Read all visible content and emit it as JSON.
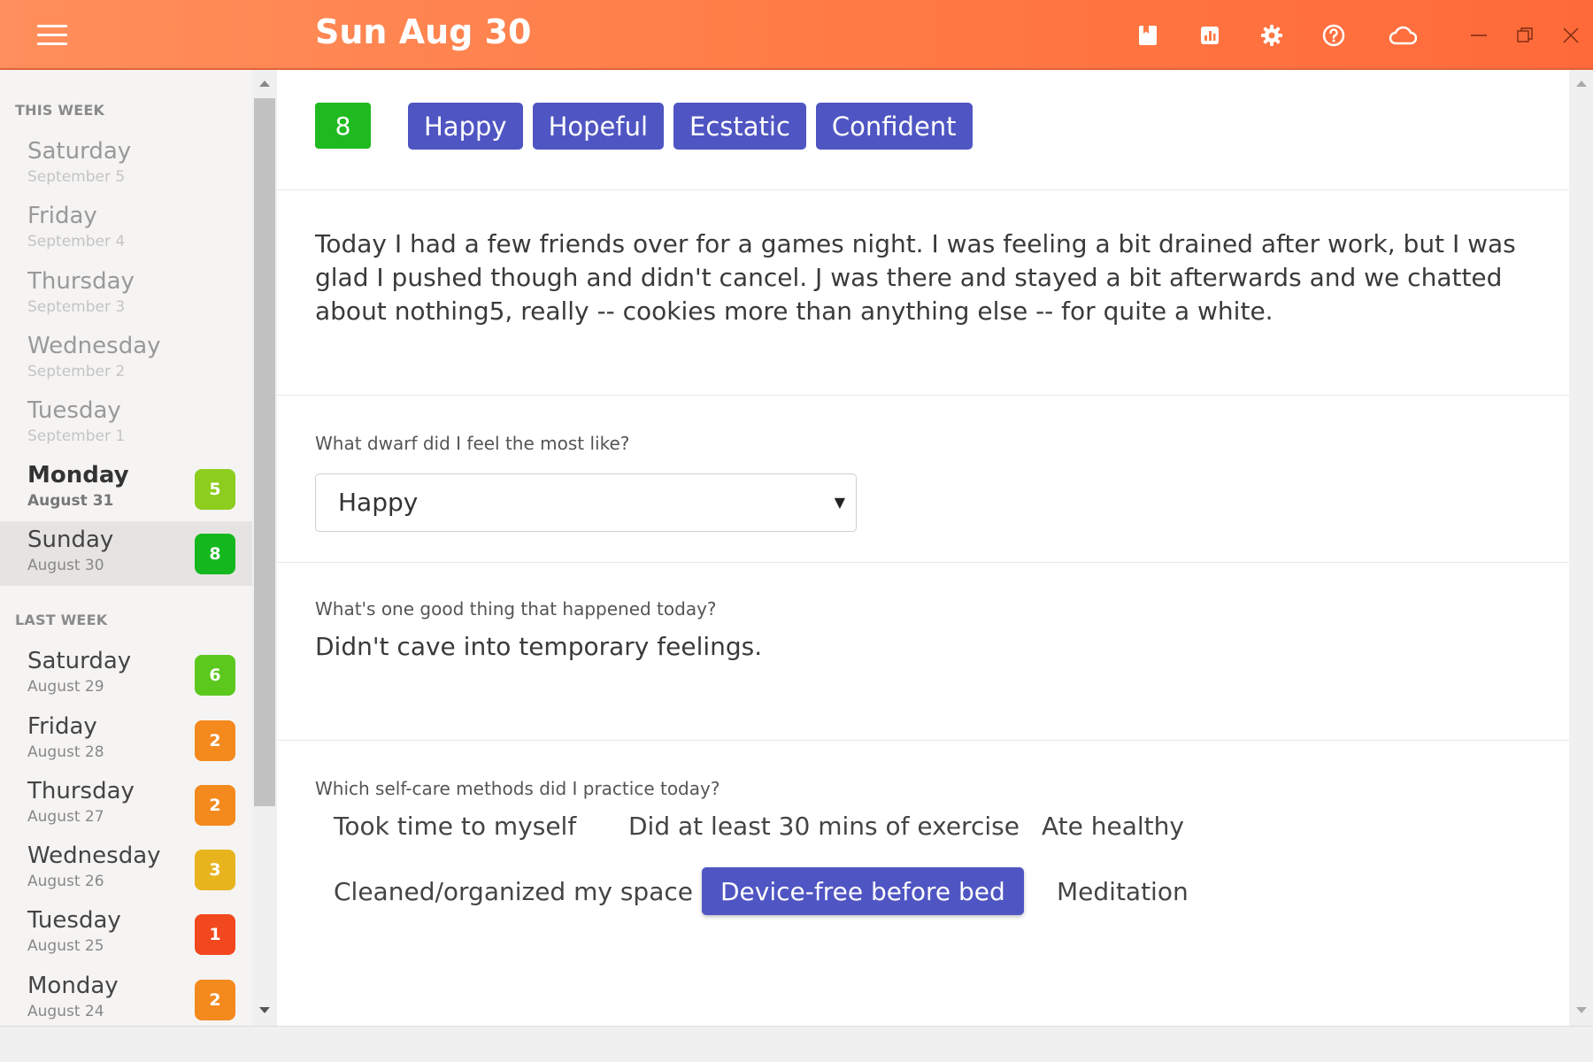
{
  "titlebar": {
    "title": "Sun Aug 30",
    "icons": [
      "journal-icon",
      "stats-icon",
      "settings-icon",
      "help-icon",
      "cloud-icon"
    ],
    "window_controls": [
      "minimize-icon",
      "restore-icon",
      "close-icon"
    ],
    "color": "#ff7a44"
  },
  "sidebar": {
    "this_week_label": "THIS WEEK",
    "last_week_label": "LAST WEEK",
    "this_week": [
      {
        "name": "Saturday",
        "date": "September 5",
        "score": null
      },
      {
        "name": "Friday",
        "date": "September 4",
        "score": null
      },
      {
        "name": "Thursday",
        "date": "September 3",
        "score": null
      },
      {
        "name": "Wednesday",
        "date": "September 2",
        "score": null
      },
      {
        "name": "Tuesday",
        "date": "September 1",
        "score": null
      },
      {
        "name": "Monday",
        "date": "August 31",
        "score": "5",
        "score_color": "#8ccd1e"
      },
      {
        "name": "Sunday",
        "date": "August 30",
        "score": "8",
        "score_color": "#14b81e"
      }
    ],
    "last_week": [
      {
        "name": "Saturday",
        "date": "August 29",
        "score": "6",
        "score_color": "#5cc81e"
      },
      {
        "name": "Friday",
        "date": "August 28",
        "score": "2",
        "score_color": "#f4891e"
      },
      {
        "name": "Thursday",
        "date": "August 27",
        "score": "2",
        "score_color": "#f4891e"
      },
      {
        "name": "Wednesday",
        "date": "August 26",
        "score": "3",
        "score_color": "#e8b41e"
      },
      {
        "name": "Tuesday",
        "date": "August 25",
        "score": "1",
        "score_color": "#f2481e"
      },
      {
        "name": "Monday",
        "date": "August 24",
        "score": "2",
        "score_color": "#f4891e"
      }
    ]
  },
  "entry": {
    "mood_score": "8",
    "mood_color": "#1fba1f",
    "tags": [
      "Happy",
      "Hopeful",
      "Ecstatic",
      "Confident"
    ],
    "text": "Today I had a few friends over for a games night. I was feeling a bit drained after work, but I was glad I pushed though and didn't cancel. J was there and stayed a bit afterwards and we chatted about nothing5, really -- cookies more than anything else -- for quite a white.",
    "q1": {
      "label": "What dwarf did I feel the most like?",
      "value": "Happy"
    },
    "q2": {
      "label": "What's one good thing that happened today?",
      "answer": "Didn't cave into temporary feelings."
    },
    "q3": {
      "label": "Which self-care methods did I practice today?",
      "options": [
        {
          "label": "Took time to myself",
          "selected": false
        },
        {
          "label": "Did at least 30 mins of exercise",
          "selected": false
        },
        {
          "label": "Ate healthy",
          "selected": false
        },
        {
          "label": "Cleaned/organized my space",
          "selected": false
        },
        {
          "label": "Device-free before bed",
          "selected": true
        },
        {
          "label": "Meditation",
          "selected": false
        }
      ]
    },
    "accent_color": "#4f55c2"
  }
}
